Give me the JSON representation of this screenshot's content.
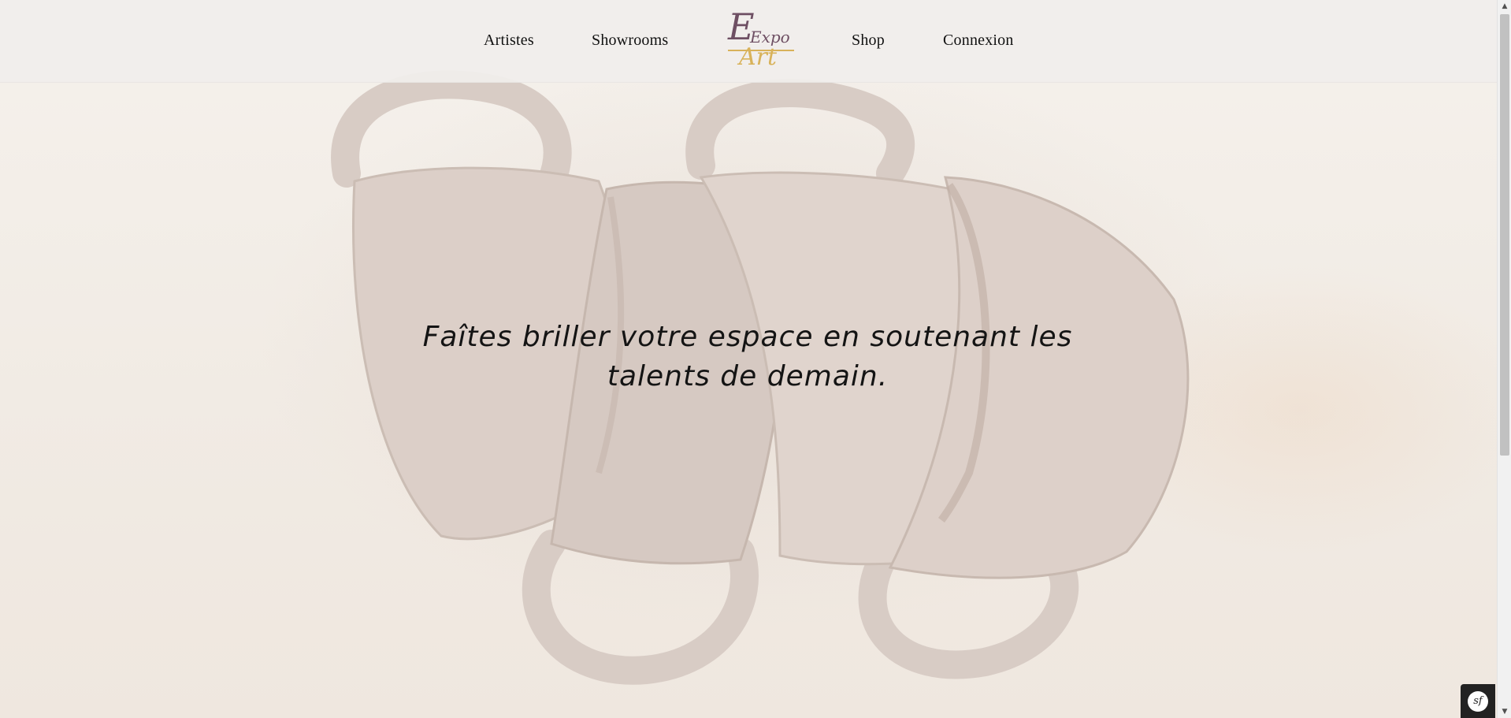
{
  "nav": {
    "artists": "Artistes",
    "showrooms": "Showrooms",
    "shop": "Shop",
    "login": "Connexion"
  },
  "logo": {
    "line1": "Expo",
    "line2": "Art"
  },
  "hero": {
    "tagline": "Faîtes briller votre espace en soutenant les talents de demain."
  },
  "debug_toolbar": {
    "label": "sf"
  },
  "colors": {
    "logo_primary": "#6e4f63",
    "logo_accent": "#d8b25a",
    "header_bg": "#f0eeec",
    "ceramic": "#dccfc8"
  }
}
